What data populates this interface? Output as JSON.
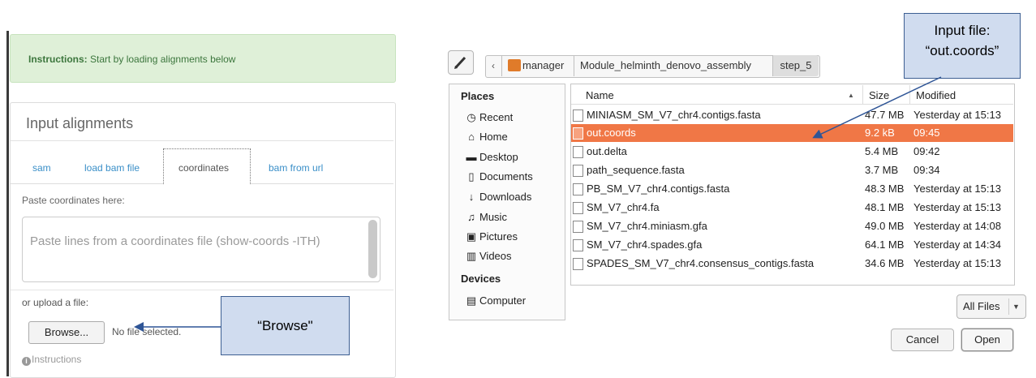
{
  "left_panel": {
    "instructions_label": "Instructions:",
    "instructions_text": " Start by loading alignments below",
    "card_title": "Input alignments",
    "tabs": [
      {
        "label": "sam"
      },
      {
        "label": "load bam file"
      },
      {
        "label": "coordinates"
      },
      {
        "label": "bam from url"
      }
    ],
    "paste_label": "Paste coordinates here:",
    "textarea_placeholder": "Paste lines from a coordinates file (show-coords -ITH)",
    "upload_label": "or upload a file:",
    "browse_label": "Browse...",
    "no_file_text": "No file selected.",
    "instructions_link": "Instructions",
    "browse_callout": "“Browse\""
  },
  "file_chooser": {
    "path_back": "‹",
    "breadcrumbs": [
      "manager",
      "Module_helminth_denovo_assembly",
      "step_5"
    ],
    "places_header": "Places",
    "places": [
      {
        "icon": "clock-icon",
        "glyph": "◷",
        "label": "Recent"
      },
      {
        "icon": "home-icon",
        "glyph": "⌂",
        "label": "Home"
      },
      {
        "icon": "folder-icon",
        "glyph": "▬",
        "label": "Desktop"
      },
      {
        "icon": "document-icon",
        "glyph": "▯",
        "label": "Documents"
      },
      {
        "icon": "download-icon",
        "glyph": "↓",
        "label": "Downloads"
      },
      {
        "icon": "music-icon",
        "glyph": "♫",
        "label": "Music"
      },
      {
        "icon": "camera-icon",
        "glyph": "▣",
        "label": "Pictures"
      },
      {
        "icon": "film-icon",
        "glyph": "▥",
        "label": "Videos"
      }
    ],
    "devices_header": "Devices",
    "devices": [
      {
        "icon": "computer-icon",
        "glyph": "▤",
        "label": "Computer"
      }
    ],
    "columns": {
      "name": "Name",
      "size": "Size",
      "modified": "Modified"
    },
    "files": [
      {
        "name": "MINIASM_SM_V7_chr4.contigs.fasta",
        "size": "47.7 MB",
        "modified": "Yesterday at 15:13",
        "selected": false
      },
      {
        "name": "out.coords",
        "size": "9.2 kB",
        "modified": "09:45",
        "selected": true
      },
      {
        "name": "out.delta",
        "size": "5.4 MB",
        "modified": "09:42",
        "selected": false
      },
      {
        "name": "path_sequence.fasta",
        "size": "3.7 MB",
        "modified": "09:34",
        "selected": false
      },
      {
        "name": "PB_SM_V7_chr4.contigs.fasta",
        "size": "48.3 MB",
        "modified": "Yesterday at 15:13",
        "selected": false
      },
      {
        "name": "SM_V7_chr4.fa",
        "size": "48.1 MB",
        "modified": "Yesterday at 15:13",
        "selected": false
      },
      {
        "name": "SM_V7_chr4.miniasm.gfa",
        "size": "49.0 MB",
        "modified": "Yesterday at 14:08",
        "selected": false
      },
      {
        "name": "SM_V7_chr4.spades.gfa",
        "size": "64.1 MB",
        "modified": "Yesterday at 14:34",
        "selected": false
      },
      {
        "name": "SPADES_SM_V7_chr4.consensus_contigs.fasta",
        "size": "34.6 MB",
        "modified": "Yesterday at 15:13",
        "selected": false
      }
    ],
    "filter_label": "All Files",
    "cancel_label": "Cancel",
    "open_label": "Open",
    "input_callout_line1": "Input file:",
    "input_callout_line2": "“out.coords”",
    "colors": {
      "selection": "#f07746",
      "callout_fill": "#d0dcef",
      "callout_border": "#3d5f92",
      "link": "#3a8fc8"
    }
  }
}
